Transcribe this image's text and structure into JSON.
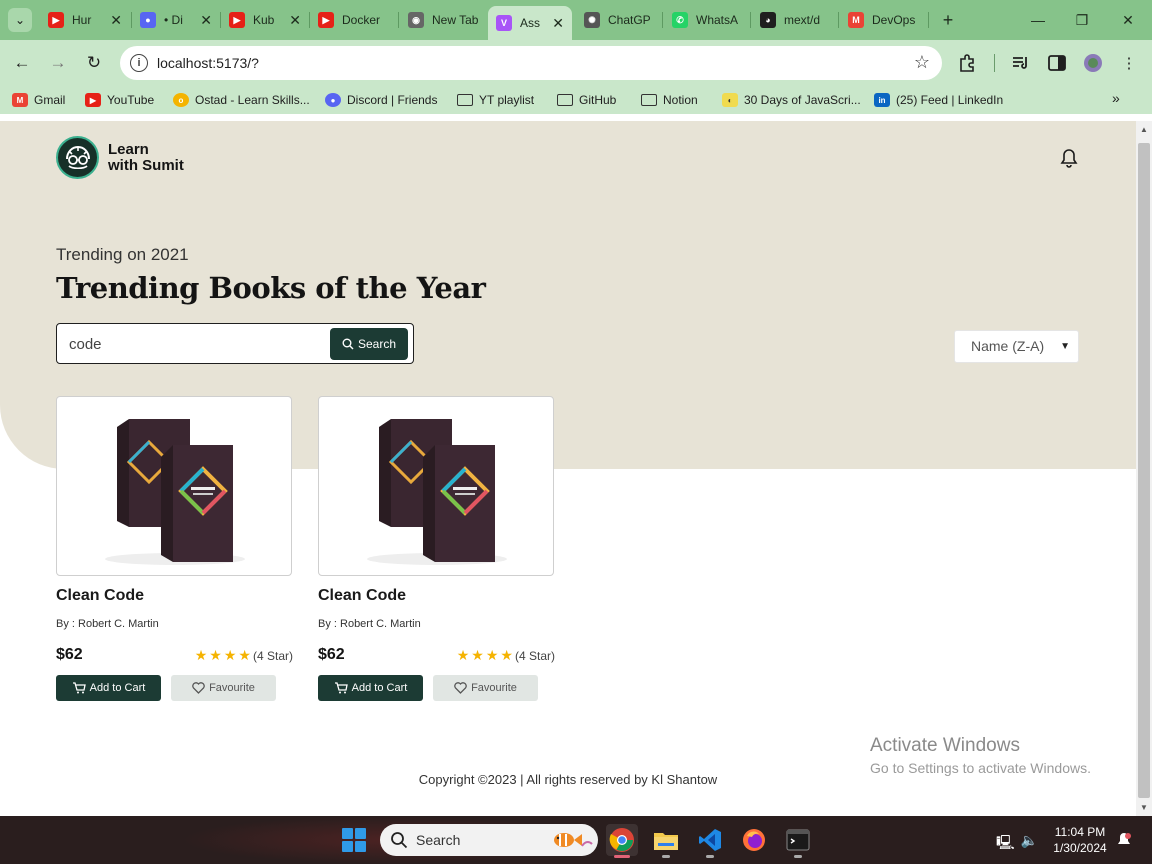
{
  "browser": {
    "tabs": [
      {
        "title": "Hur",
        "fav_color": "#e62117",
        "fav_glyph": "youtube-icon"
      },
      {
        "title": "• Di",
        "fav_color": "#5865f2",
        "fav_glyph": "discord-icon"
      },
      {
        "title": "Kub",
        "fav_color": "#e62117",
        "fav_glyph": "youtube-icon"
      },
      {
        "title": "Docker",
        "fav_color": "#e62117",
        "fav_glyph": "youtube-icon"
      },
      {
        "title": "New Tab",
        "fav_color": "#666666",
        "fav_glyph": "chrome-icon"
      },
      {
        "title": "Ass",
        "fav_color": "#a855f7",
        "fav_glyph": "vite-icon"
      },
      {
        "title": "ChatGP",
        "fav_color": "#555555",
        "fav_glyph": "openai-icon"
      },
      {
        "title": "WhatsA",
        "fav_color": "#25d366",
        "fav_glyph": "whatsapp-icon"
      },
      {
        "title": "mext/d",
        "fav_color": "#1f1f1f",
        "fav_glyph": "github-icon"
      },
      {
        "title": "DevOps",
        "fav_color": "#ea4335",
        "fav_glyph": "gmail-icon"
      }
    ],
    "url": "localhost:5173/?",
    "bookmarks": [
      {
        "label": "Gmail",
        "color": "#ea4335"
      },
      {
        "label": "YouTube",
        "color": "#e62117"
      },
      {
        "label": "Ostad - Learn Skills...",
        "color": "#f4b400"
      },
      {
        "label": "Discord | Friends",
        "color": "#5865f2"
      },
      {
        "label": "YT playlist",
        "folder": true
      },
      {
        "label": "GitHub",
        "folder": true
      },
      {
        "label": "Notion",
        "folder": true
      },
      {
        "label": "30 Days of JavaScri...",
        "color": "#f0db4f"
      },
      {
        "label": "(25) Feed | LinkedIn",
        "color": "#0a66c2"
      }
    ]
  },
  "page": {
    "logo_line1": "Learn",
    "logo_line2": "with Sumit",
    "subtitle": "Trending on 2021",
    "headline": "Trending Books of the Year",
    "search": {
      "value": "code",
      "button_label": "Search"
    },
    "sort": {
      "selected": "Name (Z-A)"
    },
    "books": [
      {
        "title": "Clean Code",
        "author": "By : Robert C. Martin",
        "price": "$62",
        "rating": 4,
        "rating_label": "(4 Star)",
        "cart_label": "Add to Cart",
        "fav_label": "Favourite"
      },
      {
        "title": "Clean Code",
        "author": "By : Robert C. Martin",
        "price": "$62",
        "rating": 4,
        "rating_label": "(4 Star)",
        "cart_label": "Add to Cart",
        "fav_label": "Favourite"
      }
    ],
    "footer": "Copyright ©2023 | All rights reserved by Kl Shantow"
  },
  "watermark": {
    "title": "Activate Windows",
    "subtitle": "Go to Settings to activate Windows."
  },
  "taskbar": {
    "search_label": "Search",
    "time": "11:04 PM",
    "date": "1/30/2024"
  },
  "colors": {
    "brand_dark": "#1c3b34",
    "hero_bg": "#e7e3d6",
    "star": "#f5b301",
    "chrome_green": "#86c38a"
  }
}
